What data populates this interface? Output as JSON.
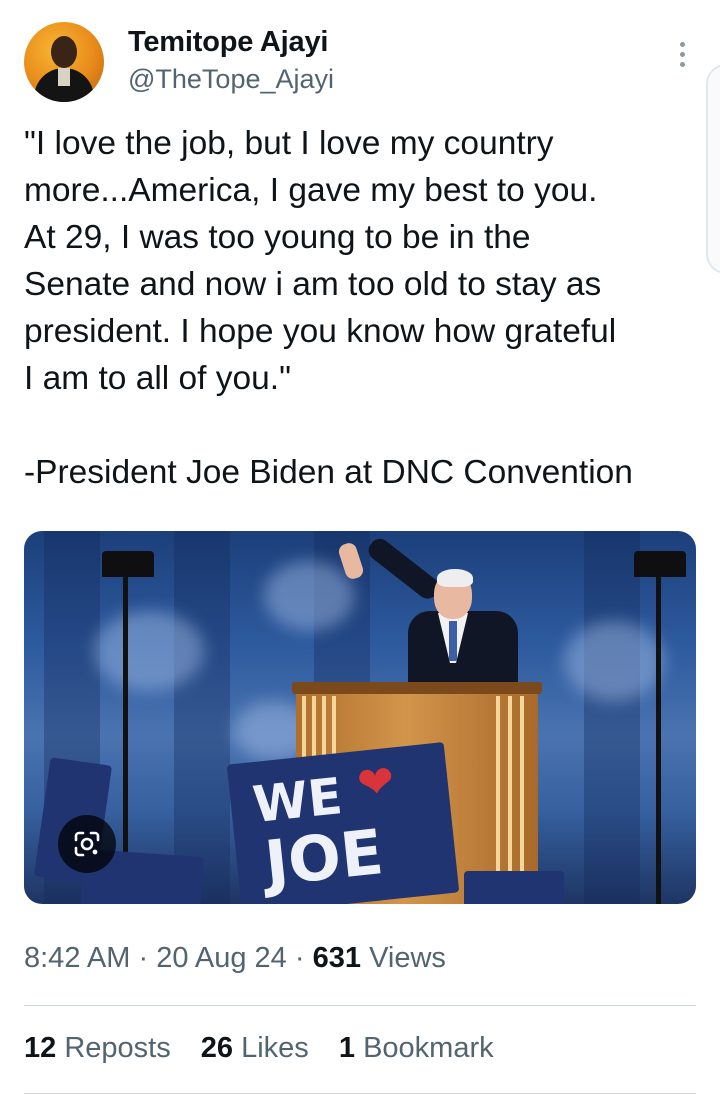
{
  "author": {
    "name": "Temitope Ajayi",
    "handle": "@TheTope_Ajayi"
  },
  "tweet": {
    "lines": [
      "\"I love the job, but I love my country",
      "more...America, I gave my best to you.",
      "At 29, I was too young to be in the",
      "Senate and now i am too old to stay as",
      "president. I hope you know how grateful",
      "I am to all of you.\""
    ],
    "attribution": "-President Joe Biden at DNC Convention"
  },
  "media": {
    "sign_text_1": "WE",
    "sign_text_2": "JOE",
    "lens_icon": "google-lens-icon"
  },
  "meta": {
    "time": "8:42 AM",
    "date": "20 Aug 24",
    "views_count": "631",
    "views_label": "Views"
  },
  "stats": {
    "reposts_count": "12",
    "reposts_label": "Reposts",
    "likes_count": "26",
    "likes_label": "Likes",
    "bookmarks_count": "1",
    "bookmarks_label": "Bookmark"
  },
  "colors": {
    "text_primary": "#0f1419",
    "text_secondary": "#536471",
    "divider": "#cfd9de"
  }
}
